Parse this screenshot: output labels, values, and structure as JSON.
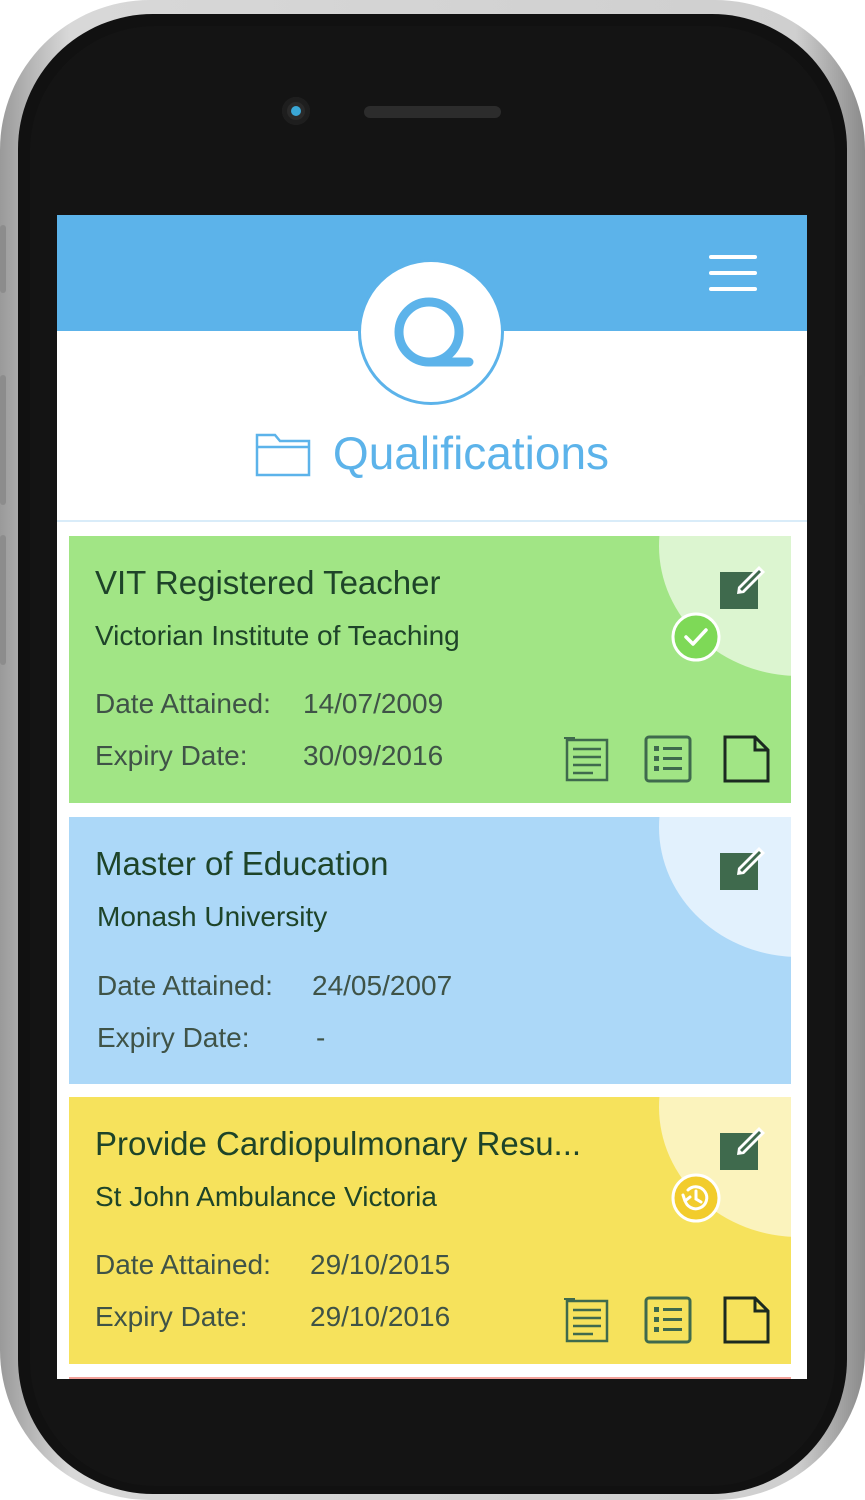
{
  "app": {
    "title": "Qualifications"
  },
  "colors": {
    "header": "#5cb3ea",
    "card_green": "#a1e585",
    "card_blue": "#acd8f8",
    "card_yellow": "#f6e25c",
    "icon_dark_green": "#3f6a4d"
  },
  "labels": {
    "date_attained": "Date Attained:",
    "expiry_date": "Expiry Date:"
  },
  "qualifications": [
    {
      "title": "VIT Registered Teacher",
      "organisation": "Victorian Institute of Teaching",
      "date_attained": "14/07/2009",
      "expiry_date": "30/09/2016",
      "status": "valid",
      "status_icon": "check-circle-icon"
    },
    {
      "title": "Master of Education",
      "organisation": "Monash University",
      "date_attained": "24/05/2007",
      "expiry_date": "-",
      "status": "no-expiry",
      "status_icon": ""
    },
    {
      "title": "Provide Cardiopulmonary Resu...",
      "organisation": "St John Ambulance Victoria",
      "date_attained": "29/10/2015",
      "expiry_date": "29/10/2016",
      "status": "expiring",
      "status_icon": "history-icon"
    }
  ]
}
